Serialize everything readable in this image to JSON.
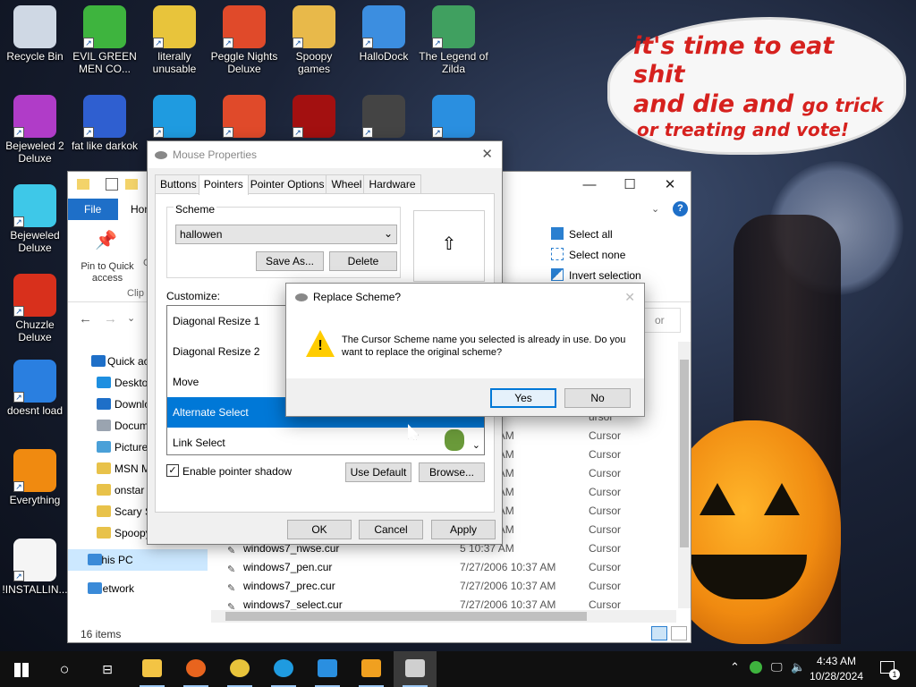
{
  "desktop": {
    "icons": [
      {
        "label": "Recycle Bin",
        "icon": "recycle-bin-icon",
        "color": "#cfd8e4"
      },
      {
        "label": "EVIL GREEN MEN CO...",
        "icon": "green-men-icon",
        "color": "#3eb43e"
      },
      {
        "label": "literally unusable",
        "icon": "chrome-icon",
        "color": "#e8c43b"
      },
      {
        "label": "Peggle Nights Deluxe",
        "icon": "peggle-icon",
        "color": "#e04a2a"
      },
      {
        "label": "Spoopy games",
        "icon": "folder-icon",
        "color": "#e8b94a"
      },
      {
        "label": "HalloDock",
        "icon": "windows-logo-icon",
        "color": "#3c8ee0"
      },
      {
        "label": "The Legend of Zilda",
        "icon": "zilda-icon",
        "color": "#40a060"
      },
      {
        "label": "Bejeweled 2 Deluxe",
        "icon": "bejeweled2-icon",
        "color": "#b03cc8"
      },
      {
        "label": "fat like darkok",
        "icon": "mpl-icon",
        "color": "#2f5fd0"
      },
      {
        "label": "",
        "icon": "edge-icon",
        "color": "#1f9be0"
      },
      {
        "label": "",
        "icon": "peggle-icon",
        "color": "#e04a2a"
      },
      {
        "label": "",
        "icon": "flash-icon",
        "color": "#a31010"
      },
      {
        "label": "",
        "icon": "shortcut-icon",
        "color": "#444444"
      },
      {
        "label": "",
        "icon": "app-icon",
        "color": "#2a8fe0"
      },
      {
        "label": "Bejeweled Deluxe",
        "icon": "diamond-icon",
        "color": "#3ec8e8"
      },
      {
        "label": "Chuzzle Deluxe",
        "icon": "chuzzle-icon",
        "color": "#d8301c"
      },
      {
        "label": "doesnt load",
        "icon": "thunderbird-icon",
        "color": "#2a7fe0"
      },
      {
        "label": "Everything",
        "icon": "search-icon",
        "color": "#f08a10"
      },
      {
        "label": "!INSTALLIN...",
        "icon": "text-file-icon",
        "color": "#f5f5f5"
      }
    ],
    "speech_bubble": {
      "line1": "it's time to eat shit",
      "line2a": "and die and",
      "line2b": "go trick",
      "line3": "or treating and vote!"
    }
  },
  "explorer": {
    "ribbon_tabs": {
      "file": "File",
      "home": "Hom"
    },
    "ribbon": {
      "pin_label": "Pin to Quick access",
      "clip_label": "Clip",
      "select_all": "Select all",
      "select_none": "Select none",
      "invert_selection": "Invert selection",
      "search_placeholder": "or"
    },
    "nav": [
      {
        "label": "Quick ac",
        "icon": "star-icon",
        "color": "#1e6fc8"
      },
      {
        "label": "Deskto",
        "icon": "desktop-icon",
        "color": "#1e8fe0"
      },
      {
        "label": "Downlo",
        "icon": "download-icon",
        "color": "#1e6fc8"
      },
      {
        "label": "Docum",
        "icon": "document-icon",
        "color": "#9aa4b0"
      },
      {
        "label": "Picture",
        "icon": "pictures-icon",
        "color": "#4aa0d8"
      },
      {
        "label": "MSN M",
        "icon": "folder-icon",
        "color": "#e8c24a"
      },
      {
        "label": "onstar",
        "icon": "folder-icon",
        "color": "#e8c24a"
      },
      {
        "label": "Scary S",
        "icon": "folder-icon",
        "color": "#e8c24a"
      },
      {
        "label": "Spoopy",
        "icon": "folder-icon",
        "color": "#e8c24a"
      },
      {
        "label": "This PC",
        "icon": "pc-icon",
        "color": "#3a8ad8"
      },
      {
        "label": "Network",
        "icon": "network-icon",
        "color": "#3a8ad8"
      }
    ],
    "files": [
      {
        "name": "",
        "date": "",
        "type": "ursor"
      },
      {
        "name": "",
        "date": "5 10:37 AM",
        "type": "Cursor"
      },
      {
        "name": "",
        "date": "5 10:37 AM",
        "type": "Cursor"
      },
      {
        "name": "",
        "date": "5 10:37 AM",
        "type": "Cursor"
      },
      {
        "name": "",
        "date": "5 10:37 AM",
        "type": "Cursor"
      },
      {
        "name": "",
        "date": "5 10:37 AM",
        "type": "Cursor"
      },
      {
        "name": "",
        "date": "5 10:37 AM",
        "type": "Cursor"
      },
      {
        "name": "windows7_nwse.cur",
        "date": "5 10:37 AM",
        "type": "Cursor"
      },
      {
        "name": "windows7_pen.cur",
        "date": "7/27/2006 10:37 AM",
        "type": "Cursor"
      },
      {
        "name": "windows7_prec.cur",
        "date": "7/27/2006 10:37 AM",
        "type": "Cursor"
      },
      {
        "name": "windows7_select.cur",
        "date": "7/27/2006 10:37 AM",
        "type": "Cursor"
      }
    ],
    "status": "16 items"
  },
  "mouse_properties": {
    "title": "Mouse Properties",
    "tabs": [
      "Buttons",
      "Pointers",
      "Pointer Options",
      "Wheel",
      "Hardware"
    ],
    "scheme_label": "Scheme",
    "scheme_value": "hallowen",
    "save_as": "Save As...",
    "delete": "Delete",
    "customize_label": "Customize:",
    "cursors": [
      "Diagonal Resize 1",
      "Diagonal Resize 2",
      "Move",
      "Alternate Select",
      "Link Select"
    ],
    "shadow_label": "Enable pointer shadow",
    "use_default": "Use Default",
    "browse": "Browse...",
    "ok": "OK",
    "cancel": "Cancel",
    "apply": "Apply"
  },
  "replace_dialog": {
    "title": "Replace Scheme?",
    "message": "The Cursor Scheme name you selected is already in use.  Do you want to replace the original scheme?",
    "yes": "Yes",
    "no": "No"
  },
  "taskbar": {
    "time": "4:43 AM",
    "date": "10/28/2024",
    "notifications": "1",
    "apps": [
      "file-explorer-icon",
      "firefox-icon",
      "chrome-icon",
      "edge-icon",
      "app-icon",
      "store-icon",
      "mouse-icon"
    ],
    "accent": "#0078d7"
  }
}
